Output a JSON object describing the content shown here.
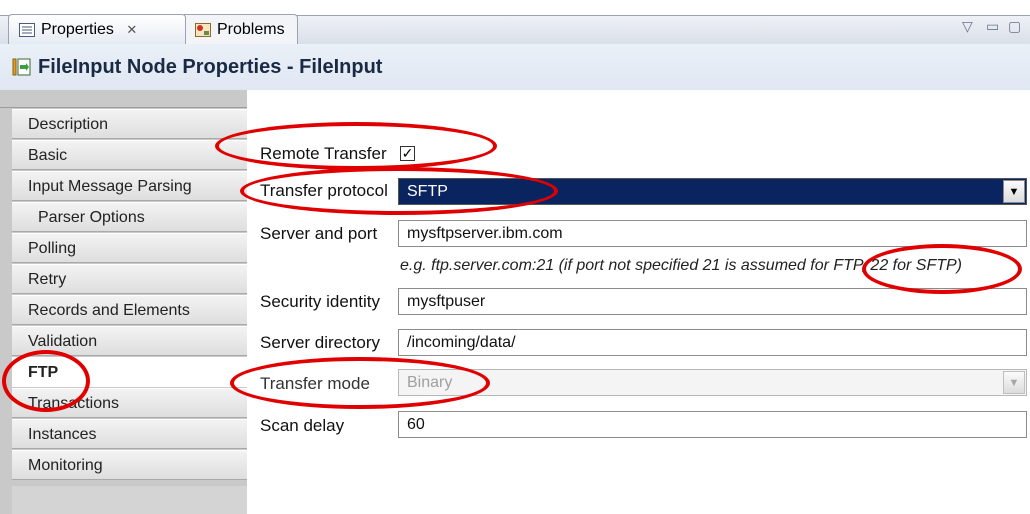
{
  "tabs": [
    {
      "label": "Properties",
      "close": "✕"
    },
    {
      "label": "Problems"
    }
  ],
  "view_controls": {
    "menu": "▽",
    "minimize": "▭",
    "maximize": "▢"
  },
  "title": "FileInput Node Properties - FileInput",
  "sidebar": {
    "items": [
      {
        "label": "Description"
      },
      {
        "label": "Basic"
      },
      {
        "label": "Input Message Parsing"
      },
      {
        "label": "Parser Options"
      },
      {
        "label": "Polling"
      },
      {
        "label": "Retry"
      },
      {
        "label": "Records and Elements"
      },
      {
        "label": "Validation"
      },
      {
        "label": "FTP"
      },
      {
        "label": "Transactions"
      },
      {
        "label": "Instances"
      },
      {
        "label": "Monitoring"
      }
    ],
    "active": "FTP"
  },
  "form": {
    "remote_transfer": {
      "label": "Remote Transfer",
      "checked": true,
      "mark": "✓"
    },
    "transfer_protocol": {
      "label": "Transfer protocol",
      "value": "SFTP"
    },
    "server_and_port": {
      "label": "Server and port",
      "value": "mysftpserver.ibm.com"
    },
    "hint": "e.g. ftp.server.com:21 (if port not specified 21 is assumed for FTP, 22 for SFTP)",
    "security_identity": {
      "label": "Security identity",
      "value": "mysftpuser"
    },
    "server_directory": {
      "label": "Server directory",
      "value": "/incoming/data/"
    },
    "transfer_mode": {
      "label": "Transfer mode",
      "value": "Binary",
      "disabled": true
    },
    "scan_delay": {
      "label": "Scan delay",
      "value": "60"
    }
  },
  "colors": {
    "annotation": "#e00000",
    "selection": "#0a2460"
  }
}
